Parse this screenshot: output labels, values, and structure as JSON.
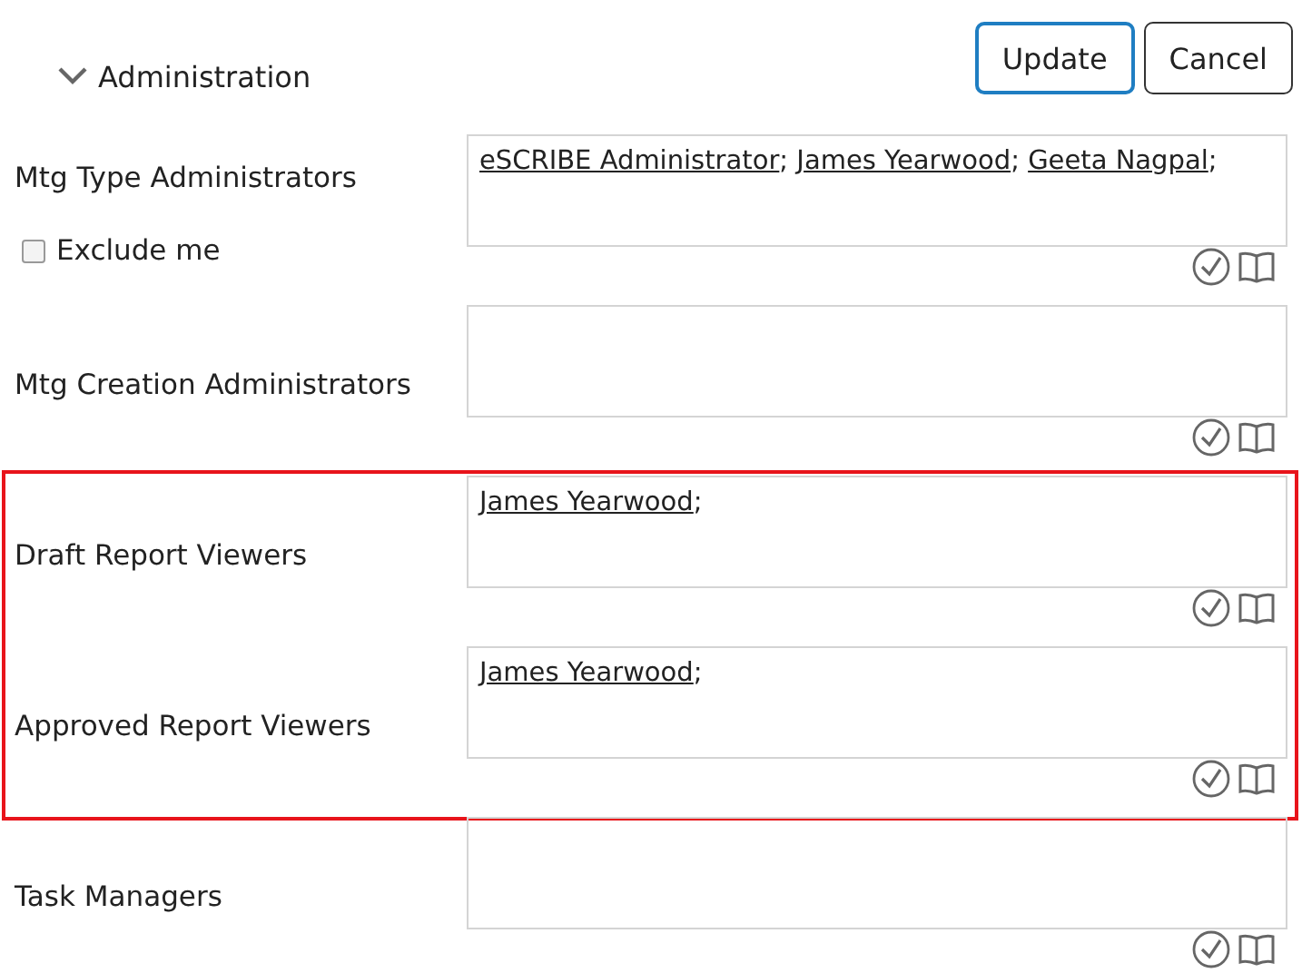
{
  "section": {
    "title": "Administration",
    "expanded": true
  },
  "buttons": [
    {
      "label": "Update",
      "kind": "primary"
    },
    {
      "label": "Cancel",
      "kind": "secondary"
    }
  ],
  "fields": [
    {
      "label": "Mtg Type Administrators",
      "names": [
        {
          "name": "eSCRIBE Administrator",
          "sep": ";"
        },
        {
          "name": "James Yearwood",
          "sep": ";"
        },
        {
          "name": "Geeta Nagpal",
          "sep": ";"
        }
      ],
      "highlighted": false,
      "option": {
        "label": "Exclude me",
        "checked": false
      }
    },
    {
      "label": "Mtg Creation Administrators",
      "highlighted": false
    },
    {
      "label": "Draft Report Viewers",
      "names": [
        {
          "name": "James Yearwood",
          "sep": ";"
        }
      ],
      "highlighted": true
    },
    {
      "label": "Approved Report Viewers",
      "names": [
        {
          "name": "James Yearwood",
          "sep": ";"
        }
      ],
      "highlighted": true
    },
    {
      "label": "Task Managers",
      "highlighted": false
    }
  ]
}
